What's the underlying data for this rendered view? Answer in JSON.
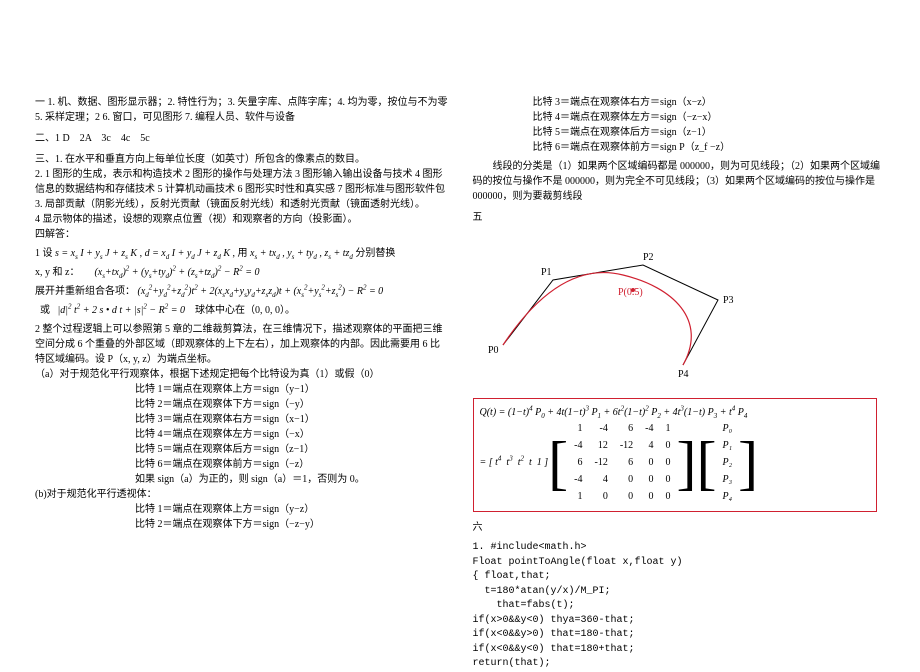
{
  "left": {
    "l1": "一 1. 机、数据、图形显示器；2. 特性行为；3. 矢量字库、点阵字库；4. 均为零，按位与不为零 5. 采样定理；2 6. 窗口，可见图形 7. 编程人员、软件与设备",
    "l2": "二、1 D　2A　3c　4c　5c",
    "l3": "三、1. 在水平和垂直方向上每单位长度（如英寸）所包含的像素点的数目。",
    "l4": "2. 1 图形的生成，表示和构造技术 2 图形的操作与处理方法 3 图形输入输出设备与技术 4 图形信息的数据结构和存储技术 5 计算机动画技术 6 图形实时性和真实感 7 图形标准与图形软件包",
    "l5": "3. 局部贡献（阴影光线），反射光贡献（镜面反射光线）和透射光贡献（镜面透射光线）。",
    "l6": "4 显示物体的描述，设想的观察点位置（视）和观察者的方向（投影面）。",
    "l7": "四解答：",
    "m1_pre": "1 设 ",
    "m1_a": "s = xₛ I + yₛ J + zₛ K",
    "m1_mid1": ", ",
    "m1_b": "d = x_d I + y_d J + z_d K",
    "m1_mid2": " , 用 ",
    "m1_c": "xₛ + t x_d , yₛ + t y_d , zₛ + t z_d",
    "m1_post": " 分别替换",
    "m2_pre": "x, y 和 z：",
    "m2": "(xₛ + t x_d)² + (yₛ + t y_d)² + (zₛ + t z_d)² − R² = 0",
    "m3_pre": "展开并重新组合各项：",
    "m3": "(x_d² + y_d² + z_d²) t² + 2(xₛ x_d + yₛ y_d + zₛ z_d) t + (xₛ² + yₛ² + zₛ²) − R² = 0",
    "m4_pre": "或",
    "m4": "|d|² t² + 2 s · d t + |s|² − R² = 0　球体中心在（0, 0, 0）。",
    "p2": "2 整个过程逻辑上可以参照第 5 章的二维裁剪算法，在三维情况下，描述观察体的平面把三维空间分成 6 个重叠的外部区域（即观察体的上下左右），加上观察体的内部。因此需要用 6 比特区域编码。设 P（x, y, z）为端点坐标。",
    "pa": "（a）对于规范化平行观察体，根据下述规定把每个比特设为真（1）或假（0）",
    "b1": "比特 1＝端点在观察体上方＝sign（y−1）",
    "b2": "比特 2＝端点在观察体下方＝sign（−y）",
    "b3": "比特 3＝端点在观察体右方＝sign（x−1）",
    "b4": "比特 4＝端点在观察体左方＝sign（−x）",
    "b5": "比特 5＝端点在观察体后方＝sign（z−1）",
    "b6": "比特 6＝端点在观察体前方＝sign（−z）",
    "b7": "如果 sign（a）为正的，则 sign（a）＝1，否则为 0。",
    "pb": "(b)对于规范化平行透视体：",
    "bb1": "比特 1＝端点在观察体上方＝sign（y−z）",
    "bb2": "比特 2＝端点在观察体下方＝sign（−z−y）"
  },
  "right": {
    "rb3": "比特 3＝端点在观察体右方＝sign（x−z）",
    "rb4": "比特 4＝端点在观察体左方＝sign（−z−x）",
    "rb5": "比特 5＝端点在观察体后方＝sign（z−1）",
    "rb6": "比特 6＝端点在观察体前方＝sign P（z_f −z）",
    "rcls": "线段的分类是（1）如果两个区域编码都是 000000，则为可见线段；（2）如果两个区域编码的按位与操作不是 000000，则为完全不可见线段；（3）如果两个区域编码的按位与操作是 000000，则为要裁剪线段",
    "five": "五",
    "diagram": {
      "P0": "P0",
      "P1": "P1",
      "P2": "P2",
      "P3": "P3",
      "P4": "P4",
      "PA": "P(0.5)"
    },
    "qt": "Q(t) = (1−t)⁴ P₀ + 4t(1−t)³ P₁ + 6t²(1−t)² P₂ + 4t³(1−t) P₃ + t⁴ P₄",
    "rowvec": "= [ t⁴  t³  t²  t  1 ]",
    "matrix": [
      [
        1,
        -4,
        6,
        -4,
        1
      ],
      [
        -4,
        12,
        -12,
        4,
        0
      ],
      [
        6,
        -12,
        6,
        0,
        0
      ],
      [
        -4,
        4,
        0,
        0,
        0
      ],
      [
        1,
        0,
        0,
        0,
        0
      ]
    ],
    "pvec": [
      "P₀",
      "P₁",
      "P₂",
      "P₃",
      "P₄"
    ],
    "six": "六",
    "code": "1. #include<math.h>\nFloat pointToAngle(float x,float y)\n{ float,that;\n  t=180*atan(y/x)/M_PI;\n    that=fabs(t);\nif(x>0&&y<0) thya=360-that;\nif(x<0&&y>0) that=180-that;\nif(x<0&&y<0) that=180+that;\nreturn(that);"
  }
}
